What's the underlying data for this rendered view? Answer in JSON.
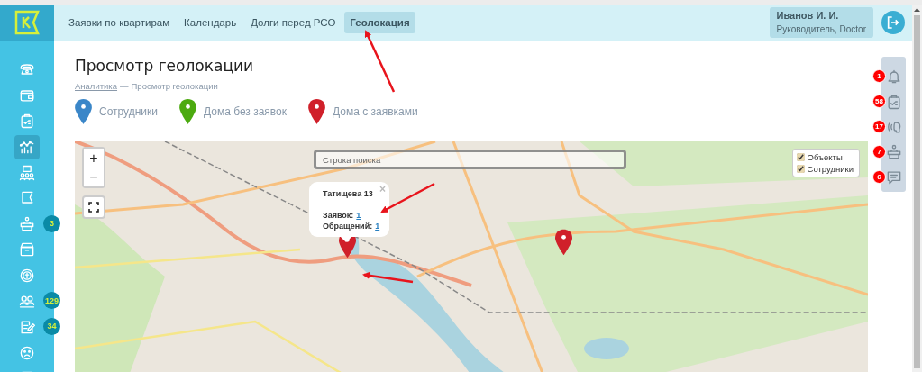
{
  "sidebar": {
    "items": [
      {
        "selected": false
      },
      {
        "selected": false
      },
      {
        "selected": false
      },
      {
        "selected": true
      },
      {
        "selected": false
      },
      {
        "selected": false
      },
      {
        "selected": false,
        "badge": "3"
      },
      {
        "selected": false
      },
      {
        "selected": false
      },
      {
        "selected": false,
        "badge": "129"
      },
      {
        "selected": false,
        "badge": "34"
      },
      {
        "selected": false
      },
      {
        "selected": false
      }
    ]
  },
  "nav": {
    "tabs": [
      {
        "label": "Заявки по квартирам",
        "selected": false
      },
      {
        "label": "Календарь",
        "selected": false
      },
      {
        "label": "Долги перед РСО",
        "selected": false
      },
      {
        "label": "Геолокация",
        "selected": true
      }
    ]
  },
  "user": {
    "name": "Иванов И. И.",
    "role": "Руководитель, Doctor"
  },
  "page": {
    "title": "Просмотр геолокации",
    "breadcrumb": {
      "link": "Аналитика",
      "separator": "—",
      "current": "Просмотр геолокации"
    }
  },
  "legend": [
    {
      "label": "Сотрудники",
      "color": "#3a86c8"
    },
    {
      "label": "Дома без заявок",
      "color": "#4caa10"
    },
    {
      "label": "Дома с заявками",
      "color": "#d0202a"
    }
  ],
  "map": {
    "zoom_in": "+",
    "zoom_out": "−",
    "search": {
      "placeholder": "Строка поиска"
    },
    "layers": [
      {
        "label": "Объекты",
        "checked": true
      },
      {
        "label": "Сотрудники",
        "checked": true
      }
    ],
    "popup": {
      "close": "×",
      "title": "Татищева 13",
      "lines": [
        {
          "label": "Заявок:",
          "value": "1"
        },
        {
          "label": "Обращений:",
          "value": "1"
        }
      ]
    },
    "markers": [
      {
        "color": "#d0202a"
      },
      {
        "color": "#d0202a"
      }
    ]
  },
  "notifications": [
    {
      "count": "1"
    },
    {
      "count": "58"
    },
    {
      "count": "17"
    },
    {
      "count": "7"
    },
    {
      "count": "6"
    }
  ]
}
